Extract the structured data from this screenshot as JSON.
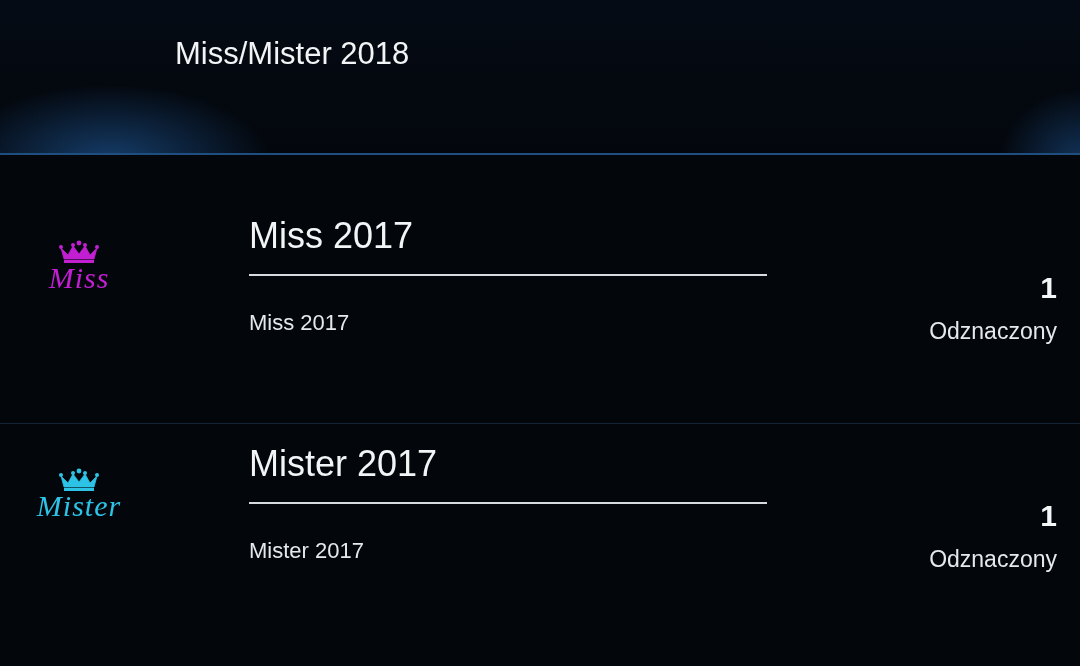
{
  "header": {
    "title": "Miss/Mister 2018"
  },
  "items": [
    {
      "logo": {
        "text": "Miss",
        "color": "#c21fd2"
      },
      "title": "Miss 2017",
      "subtitle": "Miss 2017",
      "count": "1",
      "status": "Odznaczony"
    },
    {
      "logo": {
        "text": "Mister",
        "color": "#2cc3e6"
      },
      "title": "Mister 2017",
      "subtitle": "Mister 2017",
      "count": "1",
      "status": "Odznaczony"
    }
  ]
}
